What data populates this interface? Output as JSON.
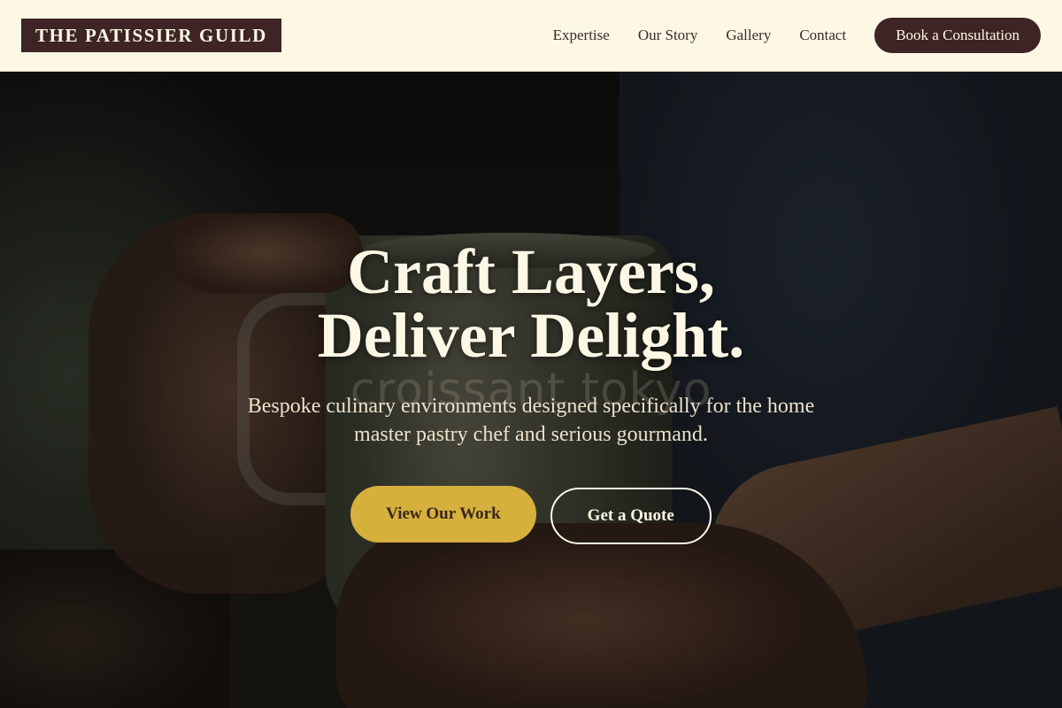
{
  "header": {
    "logo": "THE PATISSIER GUILD",
    "nav": [
      "Expertise",
      "Our Story",
      "Gallery",
      "Contact"
    ],
    "cta_label": "Book a Consultation"
  },
  "hero": {
    "headline_line1": "Craft Layers,",
    "headline_line2": "Deliver Delight.",
    "watermark": "croissant tokyo",
    "subtext": "Bespoke culinary environments designed specifically for the home master pastry chef and serious gourmand.",
    "primary_button": "View Our Work",
    "secondary_button": "Get a Quote"
  },
  "colors": {
    "header_bg": "#fdf8e6",
    "brand_dark": "#3e2424",
    "accent_gold": "#d6b03c"
  }
}
